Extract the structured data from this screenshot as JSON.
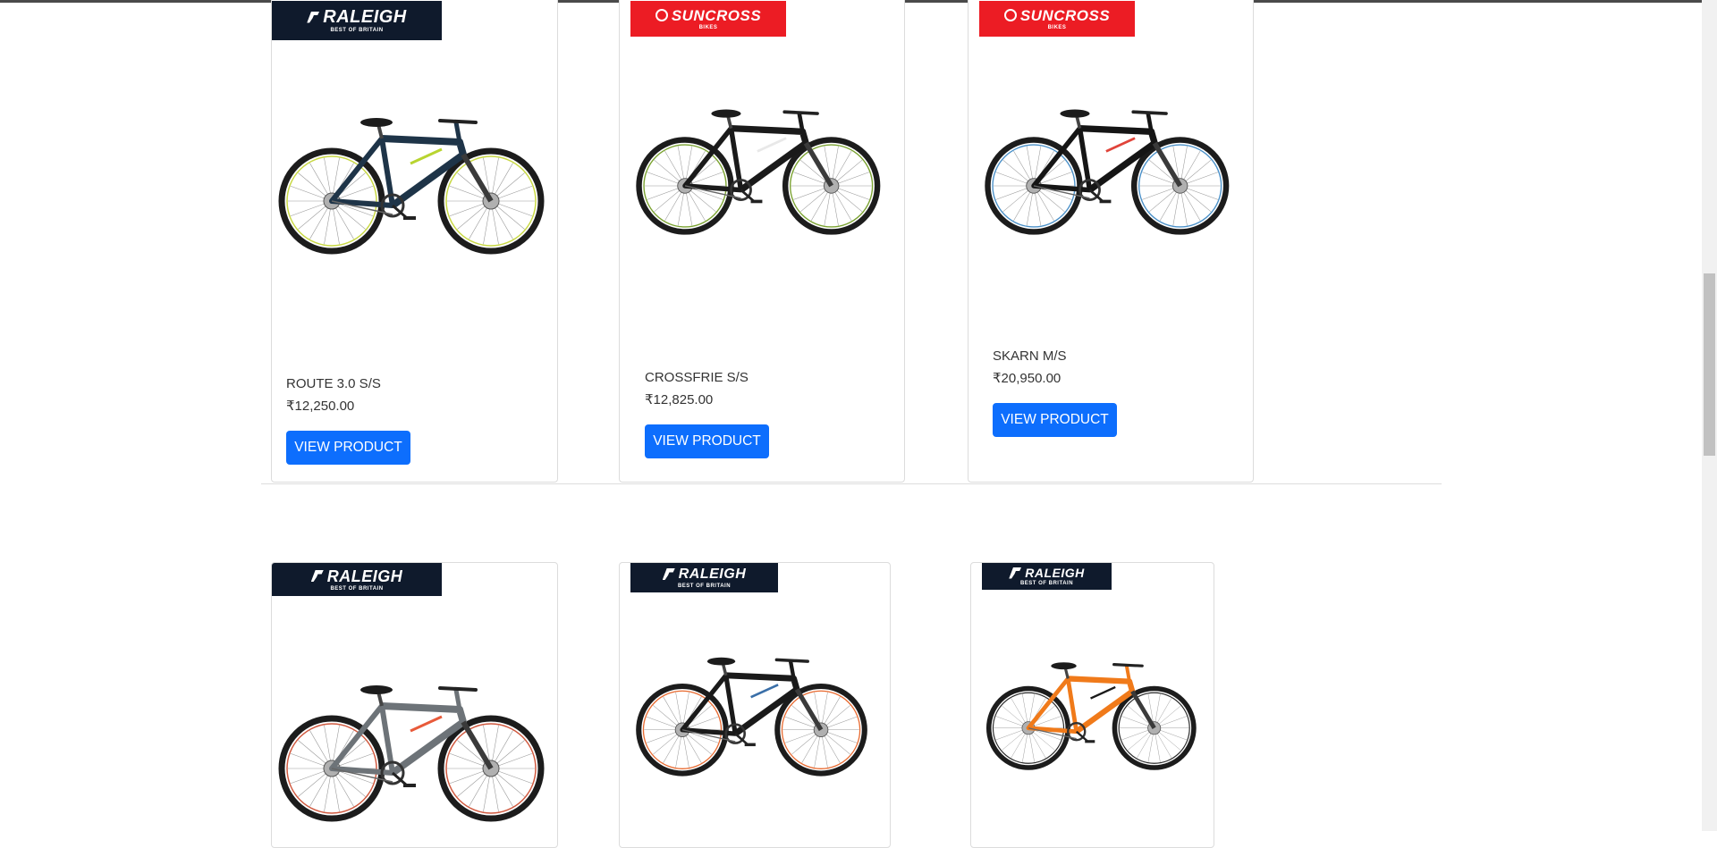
{
  "products_row1": [
    {
      "brand": "RALEIGH",
      "brand_tagline": "BEST OF BRITAIN",
      "name": "ROUTE 3.0 S/S",
      "price": "₹12,250.00",
      "button": "VIEW PRODUCT",
      "bike_colors": {
        "frame": "#1e3448",
        "accent": "#b8d430",
        "rim": "#c8d844"
      }
    },
    {
      "brand": "SUNCROSS",
      "brand_tagline": "BIKES",
      "name": "CROSSFRIE S/S",
      "price": "₹12,825.00",
      "button": "VIEW PRODUCT",
      "bike_colors": {
        "frame": "#1a1a1a",
        "accent": "#e8e8e8",
        "rim": "#7aa230"
      }
    },
    {
      "brand": "SUNCROSS",
      "brand_tagline": "BIKES",
      "name": "SKARN M/S",
      "price": "₹20,950.00",
      "button": "VIEW PRODUCT",
      "bike_colors": {
        "frame": "#151515",
        "accent": "#e0443a",
        "rim": "#4a90c8"
      }
    }
  ],
  "products_row2": [
    {
      "brand": "RALEIGH",
      "brand_tagline": "BEST OF BRITAIN",
      "bike_colors": {
        "frame": "#6d7378",
        "accent": "#e85a3a",
        "rim": "#d05a40"
      }
    },
    {
      "brand": "RALEIGH",
      "brand_tagline": "BEST OF BRITAIN",
      "bike_colors": {
        "frame": "#1a1a1a",
        "accent": "#3a6fa8",
        "rim": "#e86a30"
      }
    },
    {
      "brand": "RALEIGH",
      "brand_tagline": "BEST OF BRITAIN",
      "bike_colors": {
        "frame": "#f07a1a",
        "accent": "#1a1a1a",
        "rim": "#2a2a2a"
      }
    }
  ],
  "colors": {
    "button": "#0d6efd",
    "raleigh_badge": "#0f1a2c",
    "suncross_badge": "#ec1c24"
  }
}
